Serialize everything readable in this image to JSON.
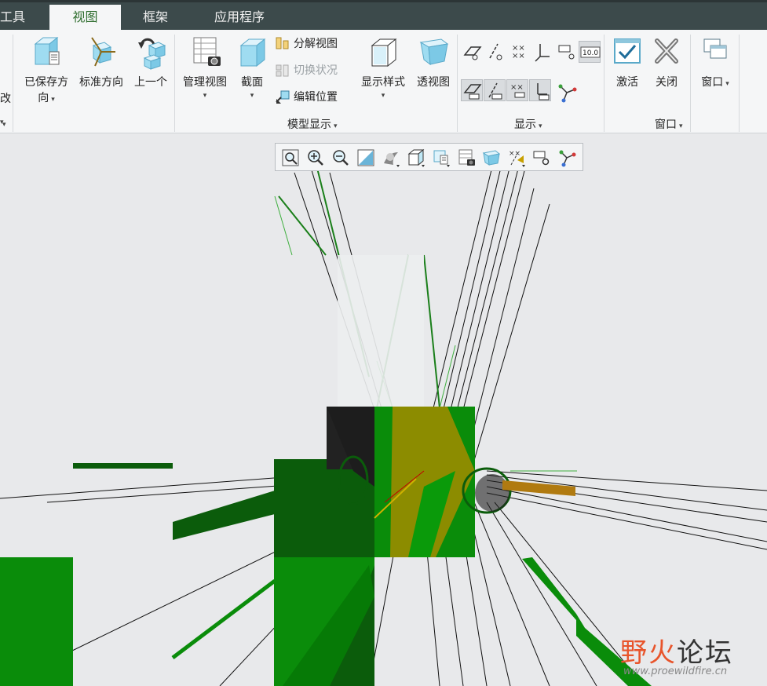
{
  "tabs": [
    {
      "label": "工具",
      "active": false
    },
    {
      "label": "视图",
      "active": true
    },
    {
      "label": "框架",
      "active": false
    },
    {
      "label": "应用程序",
      "active": false
    }
  ],
  "orientation": {
    "partial_label": "改",
    "saved_view_line1": "已保存方",
    "saved_view_line2": "向",
    "standard_orientation": "标准方向",
    "previous": "上一个"
  },
  "model_display": {
    "manage_views": "管理视图",
    "section": "截面",
    "explode_view": "分解视图",
    "toggle_status": "切换状况",
    "edit_position": "编辑位置",
    "display_style": "显示样式",
    "perspective_view": "透视图",
    "group_label": "模型显示"
  },
  "display_group": {
    "group_label": "显示",
    "dim_badge": "10.0"
  },
  "window_group": {
    "activate": "激活",
    "close": "关闭",
    "window": "窗口",
    "group_label": "窗口"
  },
  "watermark": {
    "brand_part1": "野火",
    "brand_part2": "论坛",
    "url": "www.proewildfire.cn"
  },
  "colors": {
    "tabbar": "#3c4a4b",
    "active_tab_text": "#2e6d2e",
    "ribbon_bg": "#f5f6f7",
    "viewport_bg": "#e8e9eb",
    "model_green": "#0a8c0a",
    "model_dark_green": "#0b5c0b",
    "model_olive": "#8c8c00",
    "model_orange": "#b07a10",
    "watermark_red": "#e8542b"
  }
}
